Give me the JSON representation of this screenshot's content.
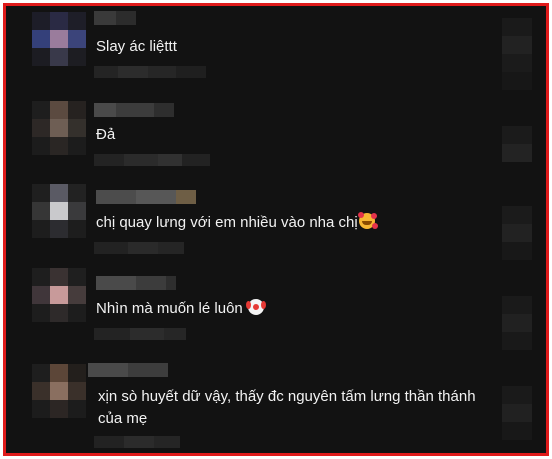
{
  "comments": [
    {
      "text": "Slay ác liệttt"
    },
    {
      "text": "Đả"
    },
    {
      "text": "chị quay lưng với em nhiều vào nha chị",
      "emoji": "smiling-face-with-hearts-icon"
    },
    {
      "text": "Nhìn mà muốn lé luôn",
      "emoji": "clown-face-icon"
    },
    {
      "text": "xịn sò huyết dữ vậy, thấy đc nguyên tấm lưng thần thánh của mẹ"
    }
  ],
  "colors": {
    "frame_border": "#e01b1b",
    "background": "#121212",
    "text": "#f2f2f2"
  }
}
